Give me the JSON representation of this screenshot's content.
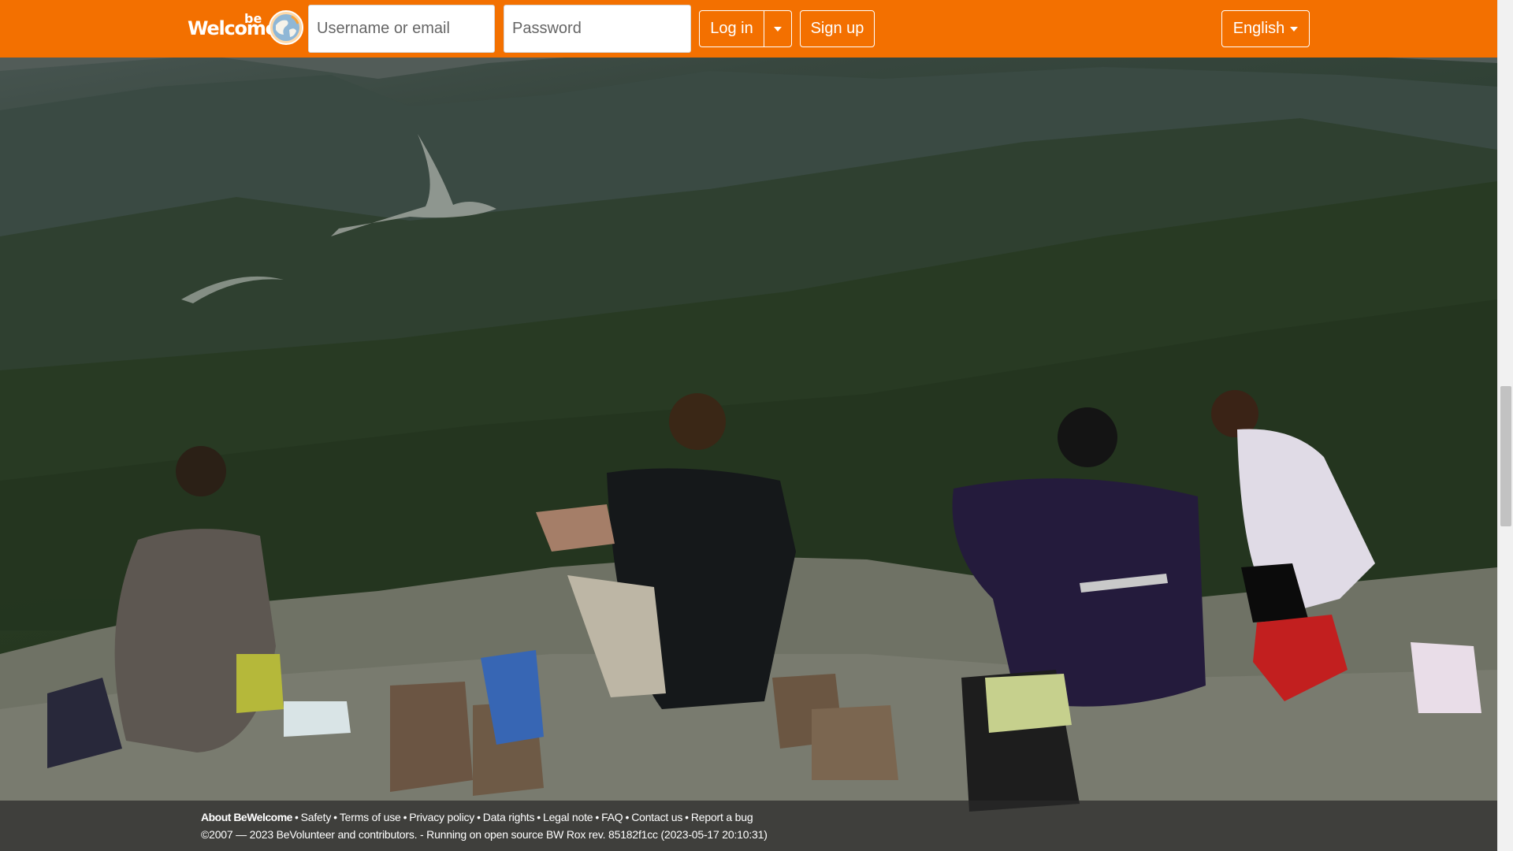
{
  "navbar": {
    "logo": {
      "word": "Welcome",
      "superscript": "be"
    },
    "username": {
      "placeholder": "Username or email",
      "value": ""
    },
    "password": {
      "placeholder": "Password",
      "value": ""
    },
    "login_label": "Log in",
    "signup_label": "Sign up",
    "language_label": "English",
    "brand_color": "#f37000"
  },
  "footer": {
    "links": [
      "About BeWelcome",
      "Safety",
      "Terms of use",
      "Privacy policy",
      "Data rights",
      "Legal note",
      "FAQ",
      "Contact us",
      "Report a bug"
    ],
    "separator": "•",
    "copyright": "©2007 — 2023 BeVolunteer and contributors. - Running on open source BW Rox rev. 85182f1cc (2023-05-17 20:10:31)"
  },
  "icons": {
    "logo_globe": "globe-icon",
    "dropdown": "caret-down-icon"
  }
}
